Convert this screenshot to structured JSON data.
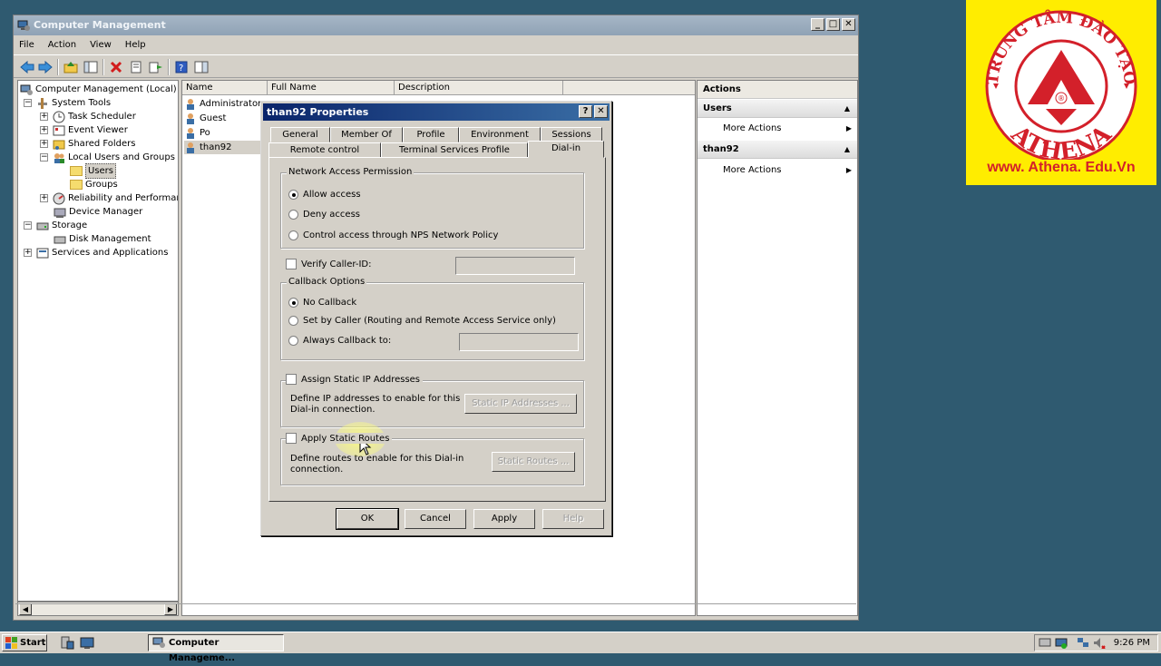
{
  "window": {
    "title": "Computer Management",
    "controls": [
      "_",
      "□",
      "✕"
    ]
  },
  "menu": [
    "File",
    "Action",
    "View",
    "Help"
  ],
  "tree": {
    "items": [
      {
        "label": "Computer Management (Local)"
      },
      {
        "label": "System Tools"
      },
      {
        "label": "Task Scheduler"
      },
      {
        "label": "Event Viewer"
      },
      {
        "label": "Shared Folders"
      },
      {
        "label": "Local Users and Groups"
      },
      {
        "label": "Users"
      },
      {
        "label": "Groups"
      },
      {
        "label": "Reliability and Performanc"
      },
      {
        "label": "Device Manager"
      },
      {
        "label": "Storage"
      },
      {
        "label": "Disk Management"
      },
      {
        "label": "Services and Applications"
      }
    ]
  },
  "list": {
    "columns": [
      "Name",
      "Full Name",
      "Description"
    ],
    "rows": [
      "Administrator",
      "Guest",
      "Po",
      "than92"
    ]
  },
  "actions": {
    "header": "Actions",
    "sections": [
      {
        "title": "Users",
        "item": "More Actions"
      },
      {
        "title": "than92",
        "item": "More Actions"
      }
    ]
  },
  "dialog": {
    "title": "than92 Properties",
    "tabs_row1": [
      "General",
      "Member Of",
      "Profile",
      "Environment",
      "Sessions"
    ],
    "tabs_row2": [
      "Remote control",
      "Terminal Services Profile",
      "Dial-in"
    ],
    "network_access": {
      "label": "Network Access Permission",
      "options": [
        "Allow access",
        "Deny access",
        "Control access through NPS Network Policy"
      ],
      "selected": "Allow access"
    },
    "verify_caller_id": "Verify Caller-ID:",
    "callback": {
      "label": "Callback Options",
      "options": [
        "No Callback",
        "Set by Caller (Routing and Remote Access Service only)",
        "Always Callback to:"
      ],
      "selected": "No Callback"
    },
    "static_ip": {
      "check_label": "Assign Static IP Addresses",
      "desc_line1": "Define IP addresses to enable for this",
      "desc_line2": "Dial-in connection.",
      "button": "Static IP Addresses ..."
    },
    "static_routes": {
      "check_label": "Apply Static Routes",
      "desc_line1": "Define routes to enable for this Dial-in",
      "desc_line2": "connection.",
      "button": "Static Routes ..."
    },
    "buttons": {
      "ok": "OK",
      "cancel": "Cancel",
      "apply": "Apply",
      "help": "Help"
    }
  },
  "logo": {
    "arc_text": "TRUNG TÂM ĐÀO TẠO",
    "name": "ATHENA",
    "url": "www. Athena. Edu.Vn",
    "colors": {
      "background": "#ffed00",
      "red": "#d3202a"
    }
  },
  "taskbar": {
    "start": "Start",
    "task": "Computer Manageme...",
    "clock": "9:26 PM"
  }
}
